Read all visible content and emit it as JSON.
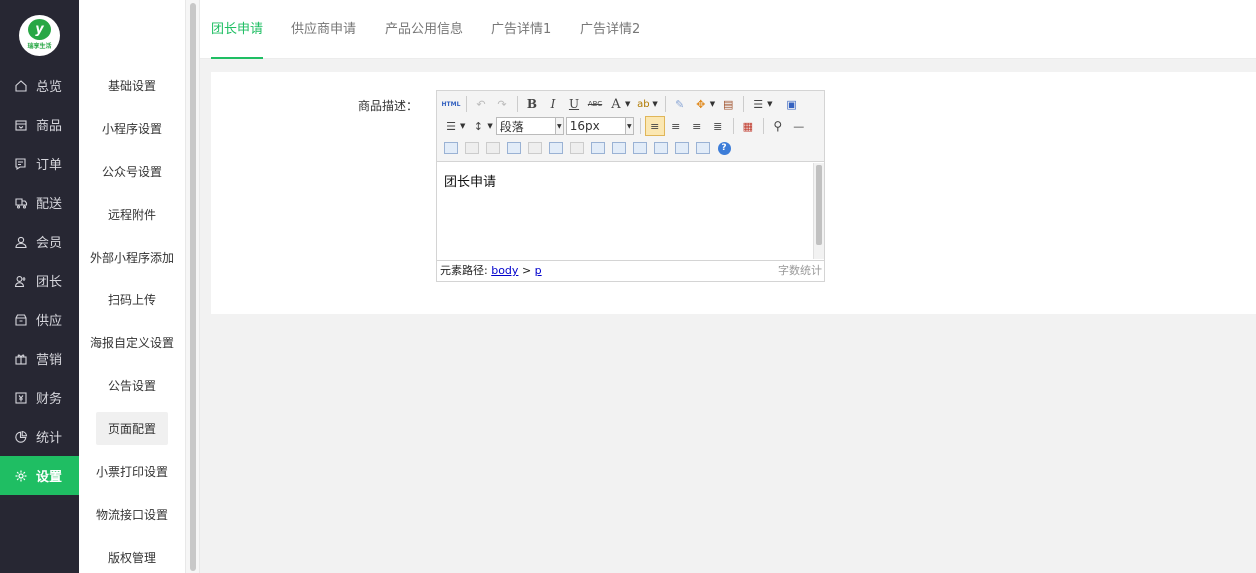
{
  "brand": {
    "logo_text": "瑞享生活",
    "mark": "y"
  },
  "main_nav": [
    {
      "label": "总览",
      "icon": "home-icon"
    },
    {
      "label": "商品",
      "icon": "box-icon"
    },
    {
      "label": "订单",
      "icon": "order-icon"
    },
    {
      "label": "配送",
      "icon": "delivery-icon"
    },
    {
      "label": "会员",
      "icon": "user-icon"
    },
    {
      "label": "团长",
      "icon": "leader-icon"
    },
    {
      "label": "供应",
      "icon": "supply-icon"
    },
    {
      "label": "营销",
      "icon": "gift-icon"
    },
    {
      "label": "财务",
      "icon": "finance-icon"
    },
    {
      "label": "统计",
      "icon": "chart-icon"
    },
    {
      "label": "设置",
      "icon": "gear-icon",
      "active": true
    }
  ],
  "sub_nav": [
    {
      "label": "基础设置"
    },
    {
      "label": "小程序设置"
    },
    {
      "label": "公众号设置"
    },
    {
      "label": "远程附件"
    },
    {
      "label": "外部小程序添加"
    },
    {
      "label": "扫码上传"
    },
    {
      "label": "海报自定义设置"
    },
    {
      "label": "公告设置"
    },
    {
      "label": "页面配置",
      "active": true
    },
    {
      "label": "小票打印设置"
    },
    {
      "label": "物流接口设置"
    },
    {
      "label": "版权管理"
    }
  ],
  "tabs": [
    {
      "label": "团长申请",
      "active": true
    },
    {
      "label": "供应商申请"
    },
    {
      "label": "产品公用信息"
    },
    {
      "label": "广告详情1"
    },
    {
      "label": "广告详情2"
    }
  ],
  "form": {
    "label": "商品描述：",
    "editor": {
      "paragraph_select": "段落",
      "font_size_select": "16px",
      "content": "团长申请",
      "path_label": "元素路径:",
      "path_body": "body",
      "path_sep": ">",
      "path_p": "p",
      "word_count_label": "字数统计"
    }
  },
  "colors": {
    "accent": "#1fbe63",
    "sidebar_bg": "#272733"
  }
}
